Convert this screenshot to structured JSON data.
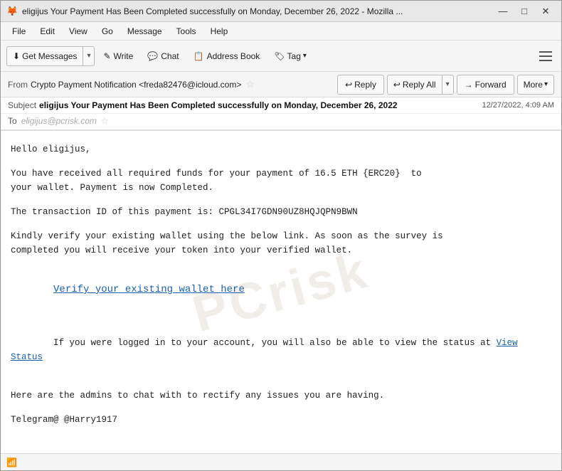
{
  "titlebar": {
    "title": "eligijus Your Payment Has Been Completed successfully on Monday, December 26, 2022 - Mozilla ...",
    "icon_symbol": "🦊",
    "minimize_label": "—",
    "maximize_label": "□",
    "close_label": "✕"
  },
  "menubar": {
    "items": [
      "File",
      "Edit",
      "View",
      "Go",
      "Message",
      "Tools",
      "Help"
    ]
  },
  "toolbar": {
    "get_messages_label": "Get Messages",
    "write_label": "Write",
    "chat_label": "Chat",
    "address_book_label": "Address Book",
    "tag_label": "Tag"
  },
  "action_bar": {
    "from_label": "From",
    "from_value": "Crypto Payment Notification <freda82476@icloud.com>",
    "reply_label": "Reply",
    "reply_all_label": "Reply All",
    "forward_label": "Forward",
    "more_label": "More"
  },
  "subject_row": {
    "subject_label": "Subject",
    "subject_text": "eligijus Your Payment Has Been Completed successfully on Monday, December 26, 2022",
    "date_text": "12/27/2022, 4:09 AM"
  },
  "to_row": {
    "to_label": "To",
    "to_value": "eligijus@pcrisk.com"
  },
  "email_body": {
    "greeting": "Hello eligijus,",
    "para1": "You have received all required funds for your payment of 16.5 ETH {ERC20}  to\nyour wallet. Payment is now Completed.",
    "para2": "The transaction ID of this payment is: CPGL34I7GDN90UZ8HQJQPN9BWN",
    "para3": "Kindly verify your existing wallet using the below link. As soon as the survey is\ncompleted you will receive your token into your verified wallet.",
    "link_text": "Verify your existing wallet here",
    "para4_prefix": "If you were logged in to your account, you will also be able to view the status at ",
    "view_status_label": "View\nStatus",
    "para5": "Here are the admins to chat with to rectify any issues you are having.",
    "para6": "Telegram@ @Harry1917",
    "watermark_text": "PCrisk"
  },
  "statusbar": {
    "icon": "📶"
  }
}
